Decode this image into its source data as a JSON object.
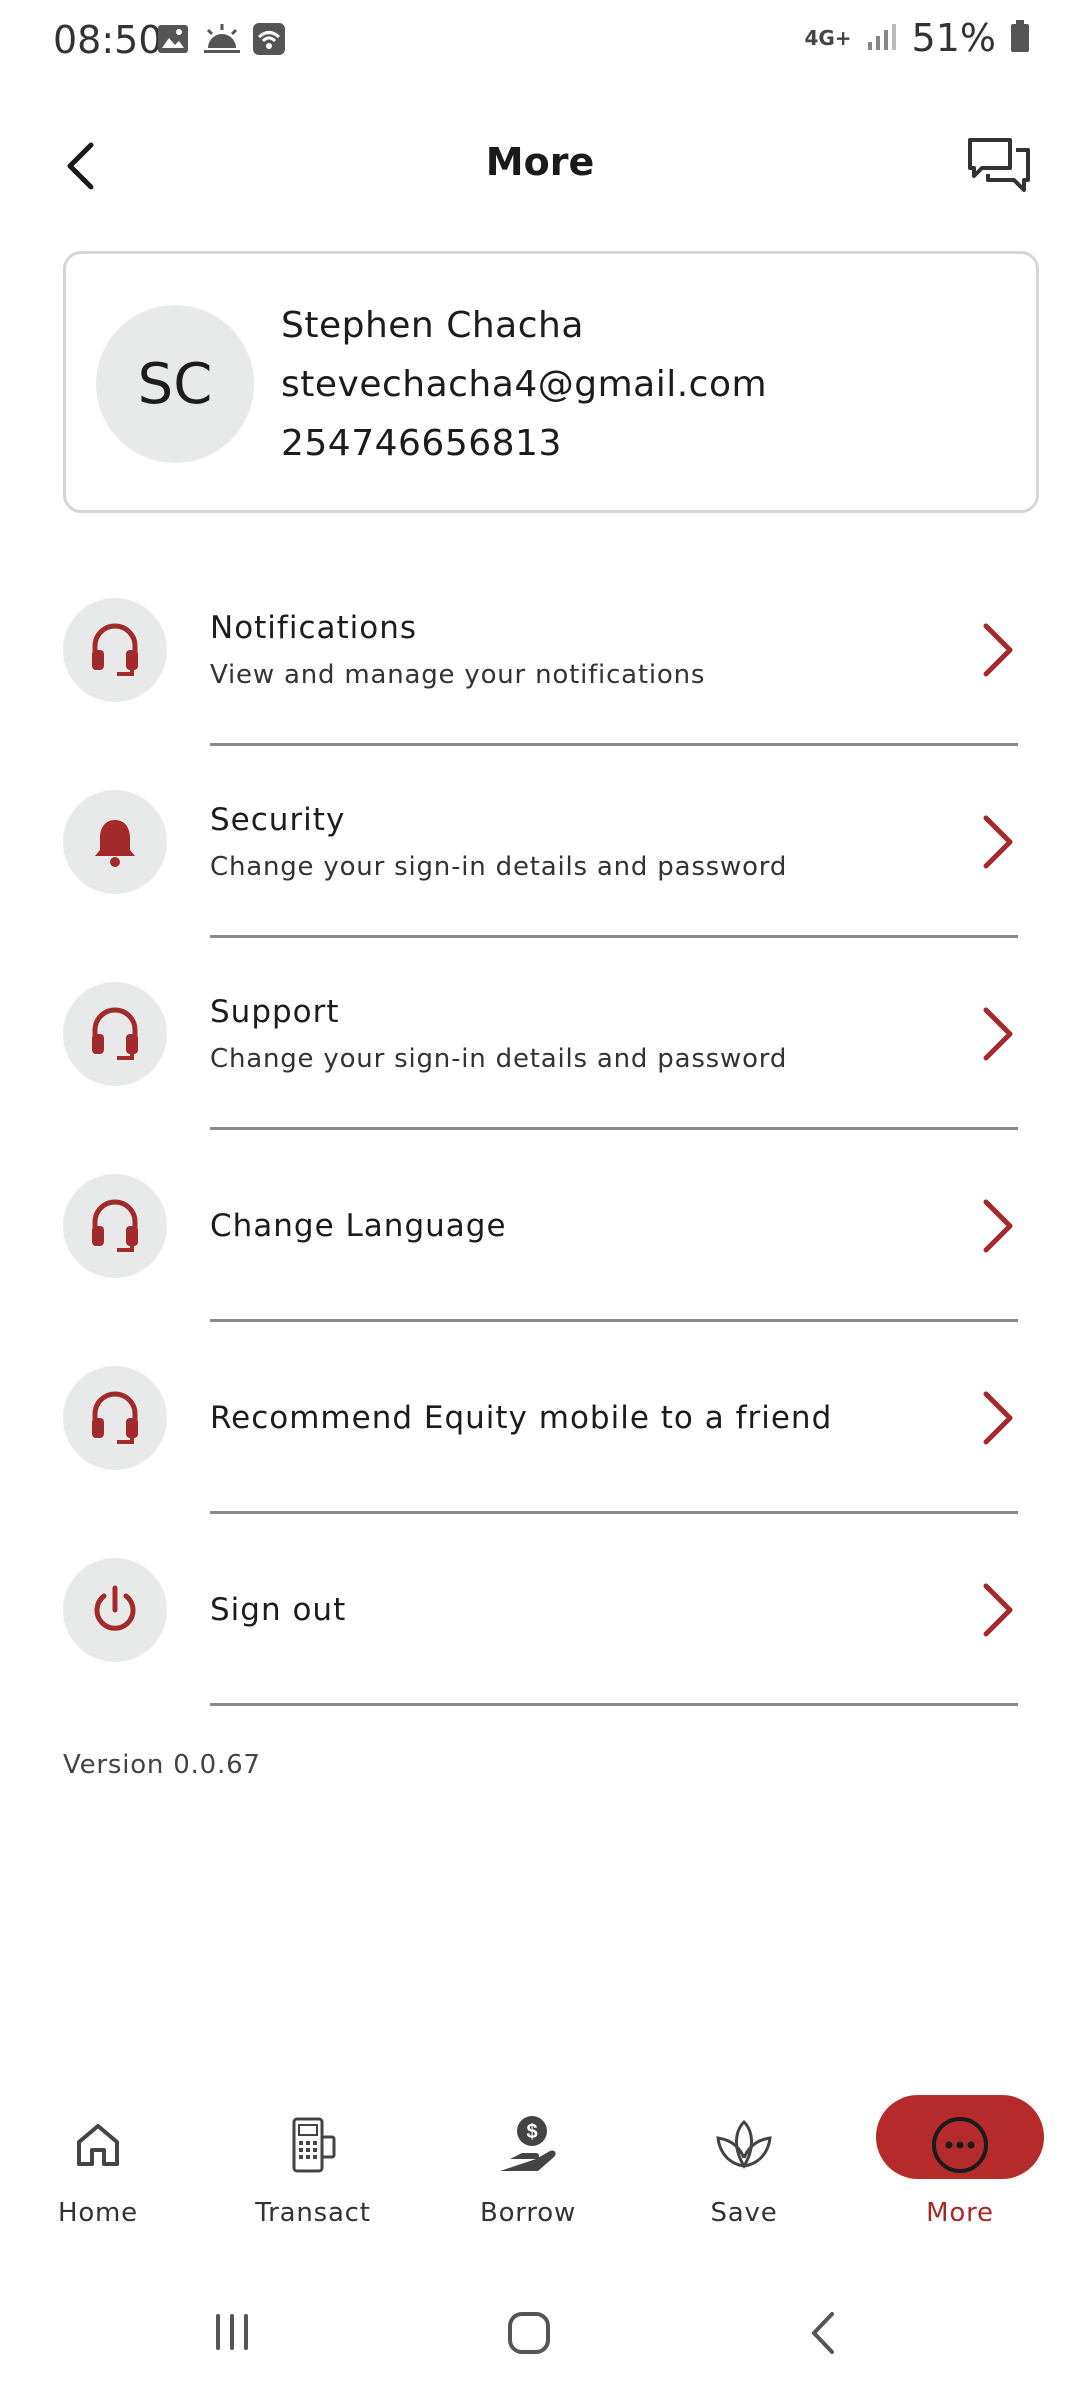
{
  "status_bar": {
    "time": "08:50",
    "network": "4G+",
    "battery": "51%"
  },
  "header": {
    "title": "More"
  },
  "profile": {
    "initials": "SC",
    "name": "Stephen Chacha",
    "email": "stevechacha4@gmail.com",
    "phone": "254746656813"
  },
  "menu": {
    "items": [
      {
        "title": "Notifications",
        "subtitle": "View and manage your notifications",
        "icon": "headset-icon"
      },
      {
        "title": "Security",
        "subtitle": "Change your sign-in details and password",
        "icon": "bell-icon"
      },
      {
        "title": "Support",
        "subtitle": "Change your sign-in details and password",
        "icon": "headset-icon"
      },
      {
        "title": "Change Language",
        "subtitle": "",
        "icon": "headset-icon"
      },
      {
        "title": "Recommend Equity mobile to a friend",
        "subtitle": "",
        "icon": "headset-icon"
      },
      {
        "title": "Sign out",
        "subtitle": "",
        "icon": "power-icon"
      }
    ]
  },
  "version": "Version 0.0.67",
  "bottom_nav": {
    "items": [
      {
        "label": "Home",
        "icon": "home-icon"
      },
      {
        "label": "Transact",
        "icon": "pos-terminal-icon"
      },
      {
        "label": "Borrow",
        "icon": "money-hand-icon"
      },
      {
        "label": "Save",
        "icon": "plant-icon"
      },
      {
        "label": "More",
        "icon": "more-dots-icon"
      }
    ],
    "active": "More"
  },
  "colors": {
    "accent": "#a22a2a",
    "icon_bg": "#e8e9e9",
    "divider": "#8a8a8a"
  }
}
